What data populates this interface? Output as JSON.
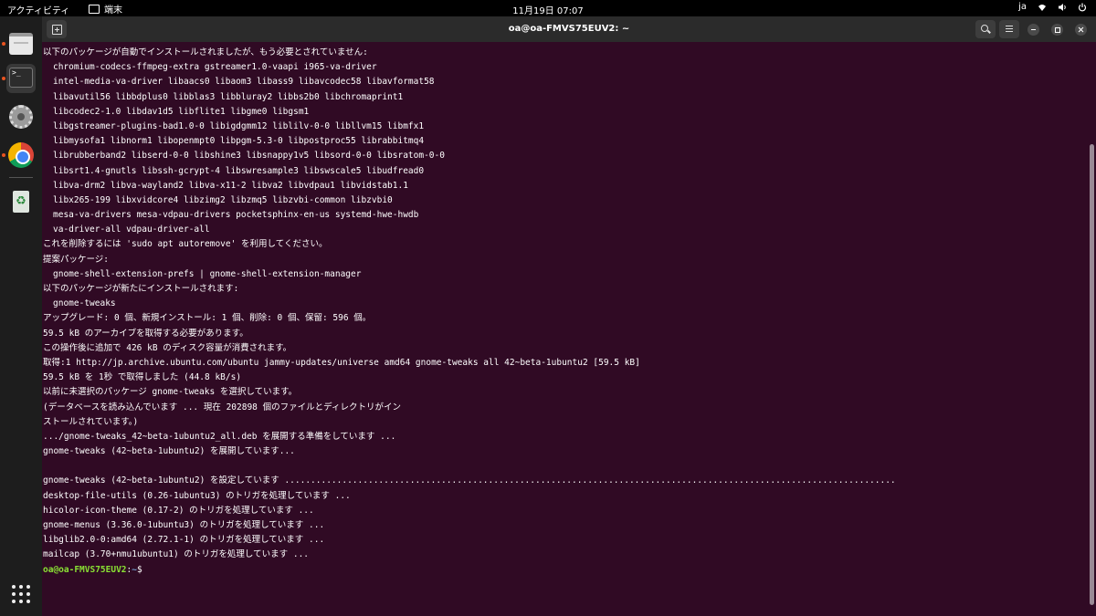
{
  "topbar": {
    "activities": "アクティビティ",
    "app_name": "端末",
    "clock": "11月19日 07:07",
    "lang": "ja",
    "icons": [
      "network-icon",
      "volume-icon",
      "power-icon"
    ]
  },
  "dock": {
    "items": [
      "files",
      "terminal",
      "settings",
      "chrome",
      "trash"
    ],
    "accent_color": "#e95420"
  },
  "window": {
    "title": "oa@oa-FMVS75EUV2: ~"
  },
  "terminal": {
    "lines": [
      {
        "text": "以下のパッケージが自動でインストールされましたが、もう必要とされていません:",
        "indent": false
      },
      {
        "text": "chromium-codecs-ffmpeg-extra gstreamer1.0-vaapi i965-va-driver",
        "indent": true
      },
      {
        "text": "intel-media-va-driver libaacs0 libaom3 libass9 libavcodec58 libavformat58",
        "indent": true
      },
      {
        "text": "libavutil56 libbdplus0 libblas3 libbluray2 libbs2b0 libchromaprint1",
        "indent": true
      },
      {
        "text": "libcodec2-1.0 libdav1d5 libflite1 libgme0 libgsm1",
        "indent": true
      },
      {
        "text": "libgstreamer-plugins-bad1.0-0 libigdgmm12 liblilv-0-0 libllvm15 libmfx1",
        "indent": true
      },
      {
        "text": "libmysofa1 libnorm1 libopenmpt0 libpgm-5.3-0 libpostproc55 librabbitmq4",
        "indent": true
      },
      {
        "text": "librubberband2 libserd-0-0 libshine3 libsnappy1v5 libsord-0-0 libsratom-0-0",
        "indent": true
      },
      {
        "text": "libsrt1.4-gnutls libssh-gcrypt-4 libswresample3 libswscale5 libudfread0",
        "indent": true
      },
      {
        "text": "libva-drm2 libva-wayland2 libva-x11-2 libva2 libvdpau1 libvidstab1.1",
        "indent": true
      },
      {
        "text": "libx265-199 libxvidcore4 libzimg2 libzmq5 libzvbi-common libzvbi0",
        "indent": true
      },
      {
        "text": "mesa-va-drivers mesa-vdpau-drivers pocketsphinx-en-us systemd-hwe-hwdb",
        "indent": true
      },
      {
        "text": "va-driver-all vdpau-driver-all",
        "indent": true
      },
      {
        "text": "これを削除するには 'sudo apt autoremove' を利用してください。",
        "indent": false
      },
      {
        "text": "提案パッケージ:",
        "indent": false
      },
      {
        "text": "gnome-shell-extension-prefs | gnome-shell-extension-manager",
        "indent": true
      },
      {
        "text": "以下のパッケージが新たにインストールされます:",
        "indent": false
      },
      {
        "text": "gnome-tweaks",
        "indent": true
      },
      {
        "text": "アップグレード: 0 個、新規インストール: 1 個、削除: 0 個、保留: 596 個。",
        "indent": false
      },
      {
        "text": "59.5 kB のアーカイブを取得する必要があります。",
        "indent": false
      },
      {
        "text": "この操作後に追加で 426 kB のディスク容量が消費されます。",
        "indent": false
      },
      {
        "text": "取得:1 http://jp.archive.ubuntu.com/ubuntu jammy-updates/universe amd64 gnome-tweaks all 42~beta-1ubuntu2 [59.5 kB]",
        "indent": false
      },
      {
        "text": "59.5 kB を 1秒 で取得しました (44.8 kB/s)",
        "indent": false
      },
      {
        "text": "以前に未選択のパッケージ gnome-tweaks を選択しています。",
        "indent": false
      },
      {
        "text": "(データベースを読み込んでいます ... 現在 202898 個のファイルとディレクトリがイン",
        "indent": false
      },
      {
        "text": "ストールされています。)",
        "indent": false
      },
      {
        "text": ".../gnome-tweaks_42~beta-1ubuntu2_all.deb を展開する準備をしています ...",
        "indent": false
      },
      {
        "text": "gnome-tweaks (42~beta-1ubuntu2) を展開しています...",
        "indent": false
      },
      {
        "text": "",
        "indent": false
      },
      {
        "text": "gnome-tweaks (42~beta-1ubuntu2) を設定しています .....................................................................................................................",
        "indent": false
      },
      {
        "text": "desktop-file-utils (0.26-1ubuntu3) のトリガを処理しています ...",
        "indent": false
      },
      {
        "text": "hicolor-icon-theme (0.17-2) のトリガを処理しています ...",
        "indent": false
      },
      {
        "text": "gnome-menus (3.36.0-1ubuntu3) のトリガを処理しています ...",
        "indent": false
      },
      {
        "text": "libglib2.0-0:amd64 (2.72.1-1) のトリガを処理しています ...",
        "indent": false
      },
      {
        "text": "mailcap (3.70+nmu1ubuntu1) のトリガを処理しています ...",
        "indent": false
      }
    ],
    "prompt": {
      "user_host": "oa@oa-FMVS75EUV2",
      "separator": ":",
      "dir": "~",
      "symbol": "$"
    },
    "colors": {
      "background": "#300a24",
      "prompt_user": "#8ae234",
      "prompt_dir": "#729fcf"
    }
  }
}
